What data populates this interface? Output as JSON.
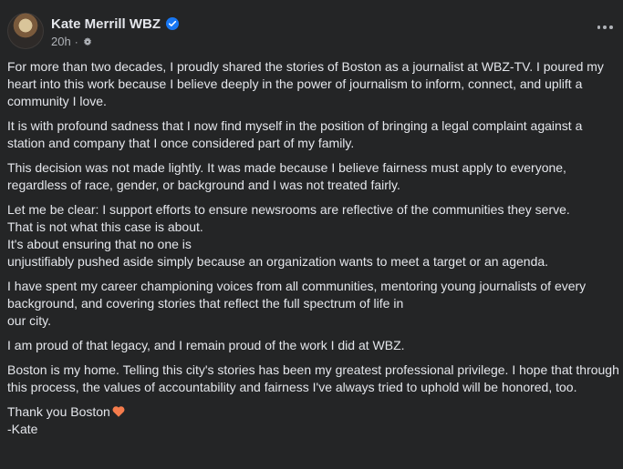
{
  "post": {
    "author": "Kate Merrill WBZ",
    "time": "20h",
    "dot": "·",
    "icons": {
      "verified": "verified-badge-icon",
      "audience": "settings-gear-icon",
      "more": "more-options-icon",
      "heart": "orange-heart-icon"
    },
    "paragraphs": [
      "For more than two decades, I proudly shared the stories of Boston as a journalist at WBZ-TV. I poured my heart into this work because I believe deeply in the power of journalism to inform, connect, and uplift a community I love.",
      "It is with profound sadness that I now find myself in the position of bringing a legal complaint against a station and company that I once considered part of my family.",
      "This decision was not made lightly. It was made because I believe fairness must apply to everyone, regardless of race, gender, or background and I was not treated fairly.",
      "Let me be clear: I support efforts to ensure newsrooms are reflective of the communities they serve.\nThat is not what this case is about.\nIt's about ensuring that no one is\nunjustifiably pushed aside simply because an organization wants to meet a target or an agenda.",
      "I have spent my career championing voices from all communities, mentoring young journalists of every background, and covering stories that reflect the full spectrum of life in\nour city.",
      "I am proud of that legacy, and I remain proud of the work I did at WBZ.",
      "Boston is my home. Telling this city's stories has been my greatest professional privilege. I hope that through this process, the values of accountability and fairness I've always tried to uphold will be honored, too."
    ],
    "closing": "Thank you Boston",
    "signature": "-Kate"
  }
}
